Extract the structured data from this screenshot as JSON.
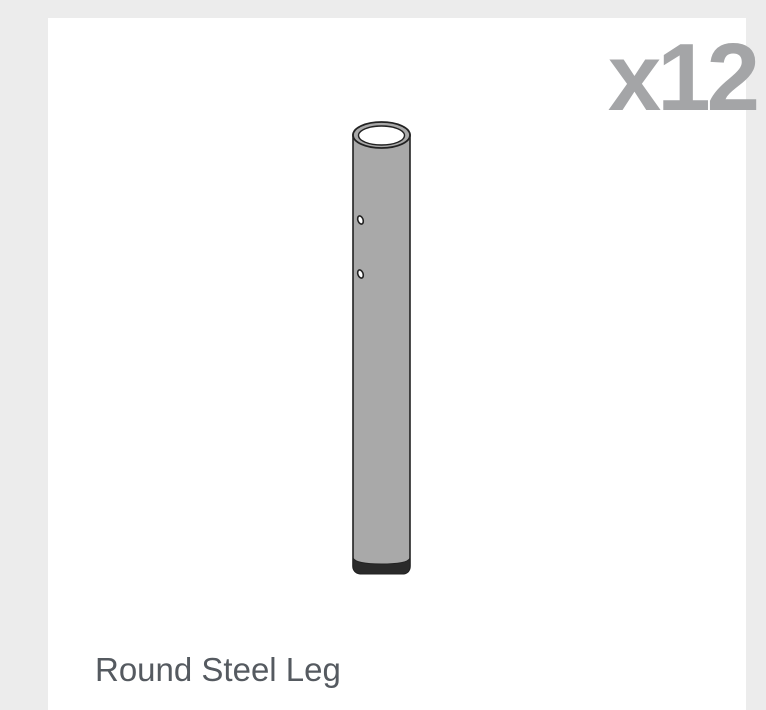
{
  "part": {
    "quantity": "x12",
    "name": "Round Steel Leg"
  },
  "colors": {
    "background": "#ececec",
    "card": "#ffffff",
    "quantity_text": "#a4a5a7",
    "name_text": "#555a60",
    "tube_fill": "#a9a9a9",
    "tube_stroke": "#222222"
  },
  "icons": {
    "leg": "steel-tube-leg-illustration"
  }
}
